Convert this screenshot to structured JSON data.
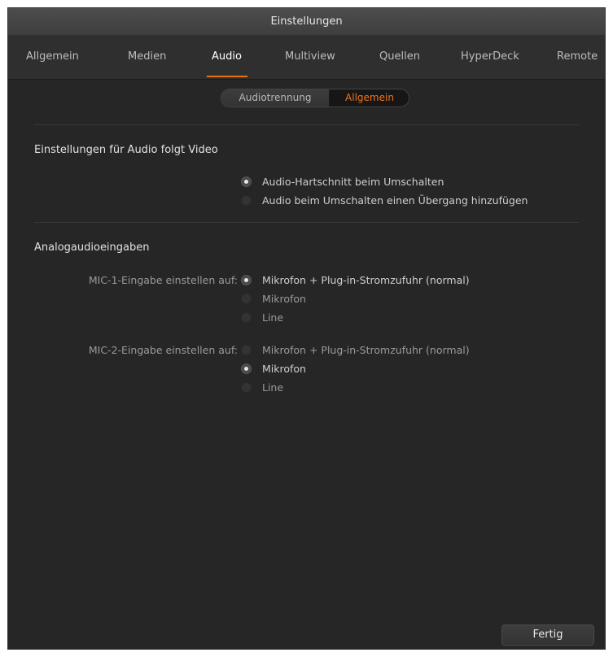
{
  "window": {
    "title": "Einstellungen"
  },
  "tabs": [
    {
      "label": "Allgemein",
      "active": false
    },
    {
      "label": "Medien",
      "active": false
    },
    {
      "label": "Audio",
      "active": true
    },
    {
      "label": "Multiview",
      "active": false
    },
    {
      "label": "Quellen",
      "active": false
    },
    {
      "label": "HyperDeck",
      "active": false
    },
    {
      "label": "Remote",
      "active": false
    }
  ],
  "segmented": {
    "options": [
      "Audiotrennung",
      "Allgemein"
    ],
    "selected": "Allgemein"
  },
  "audio_follow_video": {
    "title": "Einstellungen für Audio folgt Video",
    "options": [
      {
        "label": "Audio-Hartschnitt beim Umschalten",
        "checked": true
      },
      {
        "label": "Audio beim Umschalten einen Übergang hinzufügen",
        "checked": false
      }
    ]
  },
  "analog_inputs": {
    "title": "Analogaudioeingaben",
    "mic1": {
      "label": "MIC-1-Eingabe einstellen auf:",
      "options": [
        {
          "label": "Mikrofon + Plug-in-Stromzufuhr (normal)",
          "checked": true
        },
        {
          "label": "Mikrofon",
          "checked": false
        },
        {
          "label": "Line",
          "checked": false
        }
      ]
    },
    "mic2": {
      "label": "MIC-2-Eingabe einstellen auf:",
      "options": [
        {
          "label": "Mikrofon + Plug-in-Stromzufuhr (normal)",
          "checked": false
        },
        {
          "label": "Mikrofon",
          "checked": true
        },
        {
          "label": "Line",
          "checked": false
        }
      ]
    }
  },
  "footer": {
    "done_label": "Fertig"
  },
  "colors": {
    "accent": "#e8720c",
    "background": "#262626"
  }
}
